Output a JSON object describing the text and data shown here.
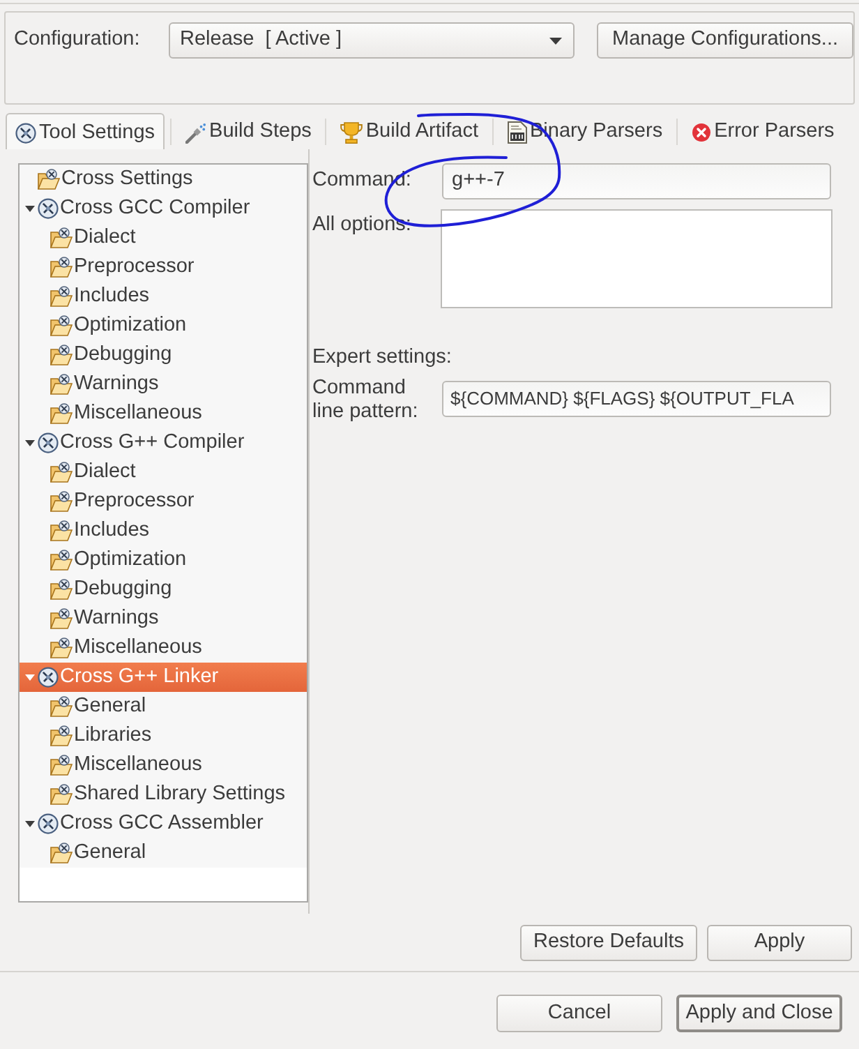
{
  "configuration": {
    "label": "Configuration:",
    "value": "Release  [ Active ]",
    "button": "Manage Configurations..."
  },
  "tabs": [
    {
      "label": "Tool Settings",
      "selected": true
    },
    {
      "label": "Build Steps",
      "selected": false
    },
    {
      "label": "Build Artifact",
      "selected": false
    },
    {
      "label": "Binary Parsers",
      "selected": false
    },
    {
      "label": "Error Parsers",
      "selected": false
    }
  ],
  "tree": [
    {
      "kind": "options",
      "label": "Cross Settings",
      "selected": false
    },
    {
      "kind": "tool",
      "label": "Cross GCC Compiler",
      "expanded": true,
      "selected": false,
      "children": [
        {
          "kind": "options",
          "label": "Dialect",
          "selected": false
        },
        {
          "kind": "options",
          "label": "Preprocessor",
          "selected": false
        },
        {
          "kind": "options",
          "label": "Includes",
          "selected": false
        },
        {
          "kind": "options",
          "label": "Optimization",
          "selected": false
        },
        {
          "kind": "options",
          "label": "Debugging",
          "selected": false
        },
        {
          "kind": "options",
          "label": "Warnings",
          "selected": false
        },
        {
          "kind": "options",
          "label": "Miscellaneous",
          "selected": false
        }
      ]
    },
    {
      "kind": "tool",
      "label": "Cross G++ Compiler",
      "expanded": true,
      "selected": false,
      "children": [
        {
          "kind": "options",
          "label": "Dialect",
          "selected": false
        },
        {
          "kind": "options",
          "label": "Preprocessor",
          "selected": false
        },
        {
          "kind": "options",
          "label": "Includes",
          "selected": false
        },
        {
          "kind": "options",
          "label": "Optimization",
          "selected": false
        },
        {
          "kind": "options",
          "label": "Debugging",
          "selected": false
        },
        {
          "kind": "options",
          "label": "Warnings",
          "selected": false
        },
        {
          "kind": "options",
          "label": "Miscellaneous",
          "selected": false
        }
      ]
    },
    {
      "kind": "tool",
      "label": "Cross G++ Linker",
      "expanded": true,
      "selected": true,
      "children": [
        {
          "kind": "options",
          "label": "General",
          "selected": false
        },
        {
          "kind": "options",
          "label": "Libraries",
          "selected": false
        },
        {
          "kind": "options",
          "label": "Miscellaneous",
          "selected": false
        },
        {
          "kind": "options",
          "label": "Shared Library Settings",
          "selected": false
        }
      ]
    },
    {
      "kind": "tool",
      "label": "Cross GCC Assembler",
      "expanded": true,
      "selected": false,
      "children": [
        {
          "kind": "options",
          "label": "General",
          "selected": false
        }
      ]
    }
  ],
  "settings": {
    "command": {
      "label": "Command:",
      "value": "g++-7"
    },
    "all_options": {
      "label": "All options:"
    },
    "expert_heading": "Expert settings:",
    "pattern": {
      "label": "Command line pattern:",
      "value": "${COMMAND} ${FLAGS} ${OUTPUT_FLA"
    }
  },
  "buttons": [
    "Restore Defaults",
    "Apply"
  ],
  "dialog_buttons": [
    {
      "label": "Cancel",
      "default": false
    },
    {
      "label": "Apply and Close",
      "default": true
    }
  ]
}
